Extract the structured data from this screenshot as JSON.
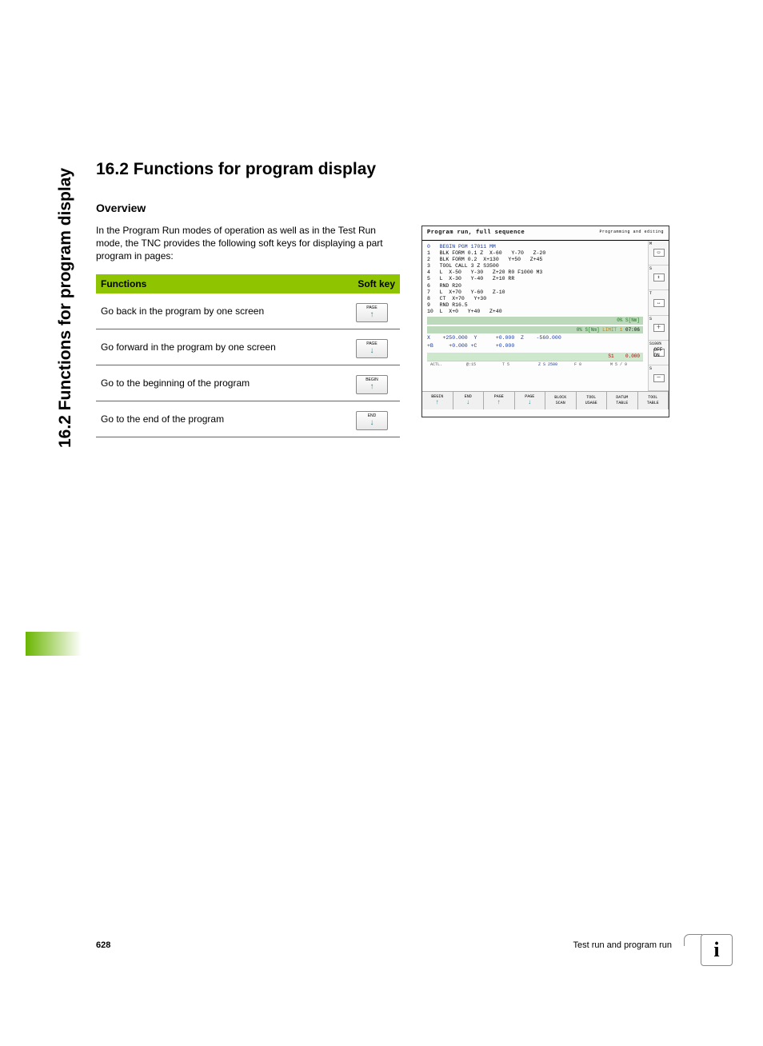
{
  "side_title": "16.2 Functions for program display",
  "heading": "16.2  Functions for program display",
  "subheading": "Overview",
  "intro": "In the Program Run modes of operation as well as in the Test Run mode, the TNC provides the following soft keys for displaying a part program in pages:",
  "table": {
    "head_functions": "Functions",
    "head_softkey": "Soft key",
    "rows": [
      {
        "desc": "Go back in the program by one screen",
        "key_label": "PAGE",
        "arrow": "↑"
      },
      {
        "desc": "Go forward in the program by one screen",
        "key_label": "PAGE",
        "arrow": "↓"
      },
      {
        "desc": "Go to the beginning of the program",
        "key_label": "BEGIN",
        "arrow": "↑"
      },
      {
        "desc": "Go to the end of the program",
        "key_label": "END",
        "arrow": "↓"
      }
    ]
  },
  "screenshot": {
    "title_left": "Program run, full sequence",
    "title_right": "Programming and editing",
    "program": [
      "0   BEGIN PGM 17011 MM",
      "1   BLK FORM 0.1 Z  X-60   Y-70   Z-20",
      "2   BLK FORM 0.2  X+130   Y+50   Z+45",
      "3   TOOL CALL 3 Z S3500",
      "4   L  X-50   Y-30   Z+20 R0 F1000 M3",
      "5   L  X-30   Y-40   Z+10 RR",
      "6   RND R20",
      "7   L  X+70   Y-60   Z-10",
      "8   CT  X+70   Y+30",
      "9   RND R16.5",
      "10  L  X+0   Y+40   Z+40"
    ],
    "status1": "0% S[Nm]",
    "status2_a": "0% S[Nm]",
    "status2_b": "LIMIT 1",
    "status2_c": "07:06",
    "pos_line1": "X    +250.000  Y      +0.000  Z    -560.000",
    "pos_line2": "+B     +0.000 +C      +0.000",
    "s_line": "S1    0.000",
    "mini": {
      "a": "ACTL.",
      "b": "@:15",
      "c": "T 5",
      "d": "Z S 2500",
      "e": "F 0",
      "f": "M 5 / 9"
    },
    "softkeys": [
      {
        "l": "BEGIN",
        "a": "↑"
      },
      {
        "l": "END",
        "a": "↓"
      },
      {
        "l": "PAGE",
        "a": "↑"
      },
      {
        "l": "PAGE",
        "a": "↓"
      },
      {
        "l": "BLOCK\nSCAN",
        "a": ""
      },
      {
        "l": "TOOL\nUSAGE",
        "a": ""
      },
      {
        "l": "DATUM\nTABLE",
        "a": ""
      },
      {
        "l": "TOOL\nTABLE",
        "a": ""
      }
    ],
    "side_buttons": [
      {
        "label": "M",
        "glyph": "▭"
      },
      {
        "label": "S",
        "glyph": "⇕"
      },
      {
        "label": "T",
        "glyph": "↔"
      },
      {
        "label": "S",
        "glyph": "＋"
      },
      {
        "label": "S100%",
        "glyph": "OFF ON"
      },
      {
        "label": "S",
        "glyph": "－"
      }
    ]
  },
  "footer": {
    "page": "628",
    "chapter": "Test run and program run"
  },
  "info_glyph": "i"
}
